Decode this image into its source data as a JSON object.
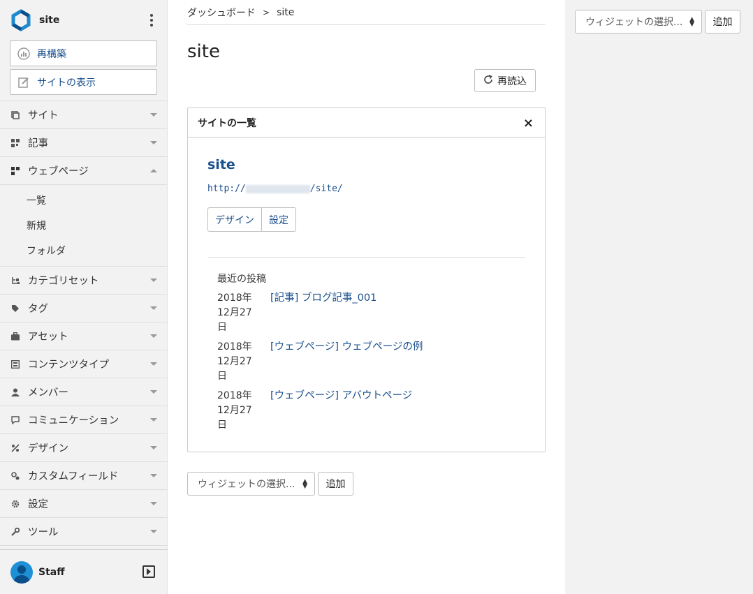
{
  "sidebar": {
    "site_name": "site",
    "buttons": {
      "rebuild": "再構築",
      "view_site": "サイトの表示"
    },
    "nav": [
      {
        "label": "サイト",
        "icon": "site-icon",
        "expanded": false
      },
      {
        "label": "記事",
        "icon": "entry-icon",
        "expanded": false
      },
      {
        "label": "ウェブページ",
        "icon": "webpage-icon",
        "expanded": true
      },
      {
        "label": "カテゴリセット",
        "icon": "category-set-icon",
        "expanded": false
      },
      {
        "label": "タグ",
        "icon": "tag-icon",
        "expanded": false
      },
      {
        "label": "アセット",
        "icon": "asset-icon",
        "expanded": false
      },
      {
        "label": "コンテンツタイプ",
        "icon": "content-type-icon",
        "expanded": false
      },
      {
        "label": "メンバー",
        "icon": "member-icon",
        "expanded": false
      },
      {
        "label": "コミュニケーション",
        "icon": "communication-icon",
        "expanded": false
      },
      {
        "label": "デザイン",
        "icon": "design-icon",
        "expanded": false
      },
      {
        "label": "カスタムフィールド",
        "icon": "custom-field-icon",
        "expanded": false
      },
      {
        "label": "設定",
        "icon": "gear-icon",
        "expanded": false
      },
      {
        "label": "ツール",
        "icon": "wrench-icon",
        "expanded": false
      }
    ],
    "webpage_sub": [
      "一覧",
      "新規",
      "フォルダ"
    ],
    "user": "Staff"
  },
  "breadcrumb": {
    "home": "ダッシュボード",
    "sep": ">",
    "current": "site"
  },
  "page_title": "site",
  "reload_label": "再読込",
  "widget": {
    "title": "サイトの一覧",
    "close": "×",
    "site_link": "site",
    "url_prefix": "http://",
    "url_suffix": "/site/",
    "design_btn": "デザイン",
    "settings_btn": "設定",
    "recent_title": "最近の投稿",
    "posts": [
      {
        "date": "2018年12月27日",
        "title": "[記事] ブログ記事_001"
      },
      {
        "date": "2018年12月27日",
        "title": "[ウェブページ] ウェブページの例"
      },
      {
        "date": "2018年12月27日",
        "title": "[ウェブページ] アバウトページ"
      }
    ]
  },
  "widget_select": {
    "placeholder": "ウィジェットの選択...",
    "add": "追加"
  },
  "colors": {
    "link": "#1a4f8e",
    "sidebar_bg": "#f2f2f2",
    "logo_blue": "#1e88d0"
  }
}
